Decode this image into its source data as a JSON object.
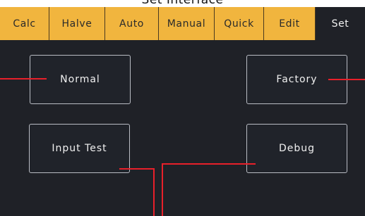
{
  "title": "Set Interface",
  "tabs": [
    {
      "label": "Calc"
    },
    {
      "label": "Halve"
    },
    {
      "label": "Auto"
    },
    {
      "label": "Manual"
    },
    {
      "label": "Quick"
    },
    {
      "label": "Edit"
    },
    {
      "label": "Set",
      "active": true
    }
  ],
  "buttons": {
    "normal": "Normal",
    "factory": "Factory",
    "input_test": "Input Test",
    "debug": "Debug"
  },
  "colors": {
    "tab_bar": "#f1b53e",
    "screen_background": "#1f2127",
    "callout_line": "#e8202a"
  }
}
